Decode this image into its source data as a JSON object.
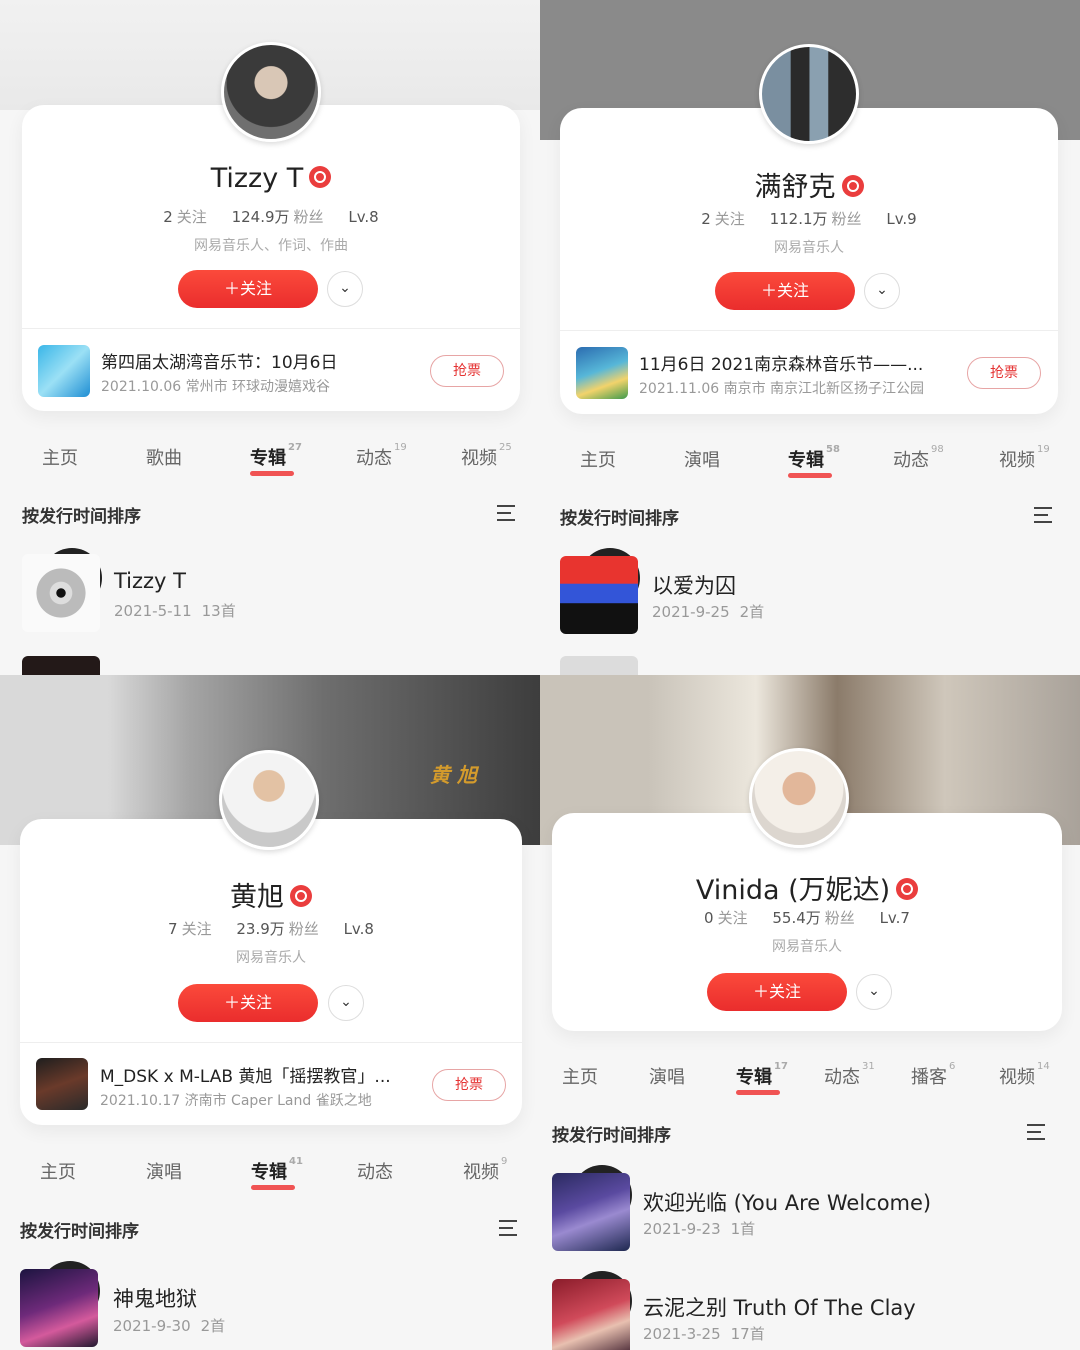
{
  "colors": {
    "accent": "#ea3d3d",
    "follow_button": "#f33b33",
    "text_dark": "#222222",
    "text_muted": "#999999"
  },
  "panels": [
    {
      "artist": {
        "name": "Tizzy T",
        "verified_icon": "verified-musician-badge-icon",
        "following": "2",
        "following_label": "关注",
        "fans": "124.9万",
        "fans_label": "粉丝",
        "level": "Lv.8",
        "description": "网易音乐人、作词、作曲"
      },
      "follow_label": "＋关注",
      "event": {
        "title": "第四届太湖湾音乐节：10月6日",
        "subtitle": "2021.10.06 常州市 环球动漫嬉戏谷",
        "ticket_label": "抢票"
      },
      "tabs": [
        {
          "label": "主页",
          "count": ""
        },
        {
          "label": "歌曲",
          "count": ""
        },
        {
          "label": "专辑",
          "count": "27",
          "active": true
        },
        {
          "label": "动态",
          "count": "19"
        },
        {
          "label": "视频",
          "count": "25"
        }
      ],
      "sort_label": "按发行时间排序",
      "albums": [
        {
          "title": "Tizzy T",
          "date": "2021-5-11",
          "tracks": "13首"
        }
      ]
    },
    {
      "artist": {
        "name": "满舒克",
        "verified_icon": "verified-musician-badge-icon",
        "following": "2",
        "following_label": "关注",
        "fans": "112.1万",
        "fans_label": "粉丝",
        "level": "Lv.9",
        "description": "网易音乐人"
      },
      "follow_label": "＋关注",
      "event": {
        "title": "11月6日 2021南京森林音乐节——...",
        "subtitle": "2021.11.06 南京市 南京江北新区扬子江公园",
        "ticket_label": "抢票"
      },
      "tabs": [
        {
          "label": "主页",
          "count": ""
        },
        {
          "label": "演唱",
          "count": ""
        },
        {
          "label": "专辑",
          "count": "58",
          "active": true
        },
        {
          "label": "动态",
          "count": "98"
        },
        {
          "label": "视频",
          "count": "19"
        }
      ],
      "sort_label": "按发行时间排序",
      "albums": [
        {
          "title": "以爱为囚",
          "date": "2021-9-25",
          "tracks": "2首"
        }
      ]
    },
    {
      "banner_text": "黄 旭",
      "artist": {
        "name": "黄旭",
        "verified_icon": "verified-musician-badge-icon",
        "following": "7",
        "following_label": "关注",
        "fans": "23.9万",
        "fans_label": "粉丝",
        "level": "Lv.8",
        "description": "网易音乐人"
      },
      "follow_label": "＋关注",
      "event": {
        "title": "M_DSK x M-LAB 黄旭「摇摆教官」...",
        "subtitle": "2021.10.17 济南市 Caper Land 雀跃之地",
        "ticket_label": "抢票"
      },
      "tabs": [
        {
          "label": "主页",
          "count": ""
        },
        {
          "label": "演唱",
          "count": ""
        },
        {
          "label": "专辑",
          "count": "41",
          "active": true
        },
        {
          "label": "动态",
          "count": ""
        },
        {
          "label": "视频",
          "count": "9"
        }
      ],
      "sort_label": "按发行时间排序",
      "albums": [
        {
          "title": "神鬼地狱",
          "date": "2021-9-30",
          "tracks": "2首"
        }
      ]
    },
    {
      "artist": {
        "name": "Vinida (万妮达)",
        "verified_icon": "verified-musician-badge-icon",
        "following": "0",
        "following_label": "关注",
        "fans": "55.4万",
        "fans_label": "粉丝",
        "level": "Lv.7",
        "description": "网易音乐人"
      },
      "follow_label": "＋关注",
      "tabs": [
        {
          "label": "主页",
          "count": ""
        },
        {
          "label": "演唱",
          "count": ""
        },
        {
          "label": "专辑",
          "count": "17",
          "active": true
        },
        {
          "label": "动态",
          "count": "31"
        },
        {
          "label": "播客",
          "count": "6"
        },
        {
          "label": "视频",
          "count": "14"
        }
      ],
      "sort_label": "按发行时间排序",
      "albums": [
        {
          "title": "欢迎光临 (You Are Welcome)",
          "date": "2021-9-23",
          "tracks": "1首"
        },
        {
          "title": "云泥之别 Truth Of The Clay",
          "date": "2021-3-25",
          "tracks": "17首"
        }
      ]
    }
  ]
}
